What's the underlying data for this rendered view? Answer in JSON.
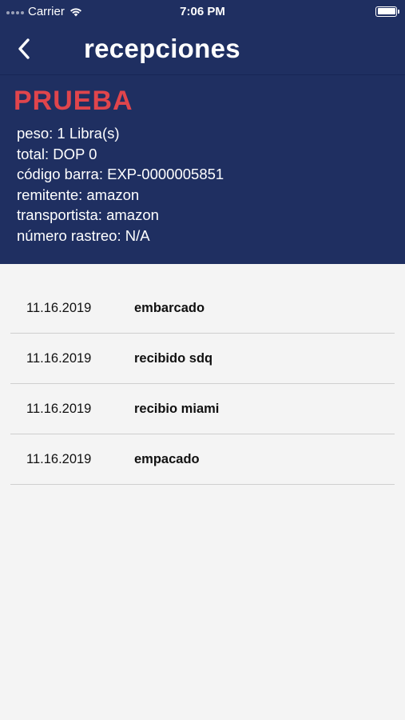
{
  "status_bar": {
    "carrier": "Carrier",
    "time": "7:06 PM"
  },
  "nav": {
    "title": "recepciones",
    "back_icon": "chevron-left-icon"
  },
  "package": {
    "title": "PRUEBA",
    "lines": [
      "peso: 1 Libra(s)",
      "total: DOP 0",
      "código barra: EXP-0000005851",
      "remitente: amazon",
      "transportista: amazon",
      "número rastreo: N/A"
    ]
  },
  "tracking": [
    {
      "date": "11.16.2019",
      "status": "embarcado"
    },
    {
      "date": "11.16.2019",
      "status": "recibido sdq"
    },
    {
      "date": "11.16.2019",
      "status": "recibio miami"
    },
    {
      "date": "11.16.2019",
      "status": "empacado"
    }
  ],
  "colors": {
    "header_bg": "#1f2f61",
    "title_red": "#e0454c",
    "list_bg": "#f4f4f4"
  }
}
